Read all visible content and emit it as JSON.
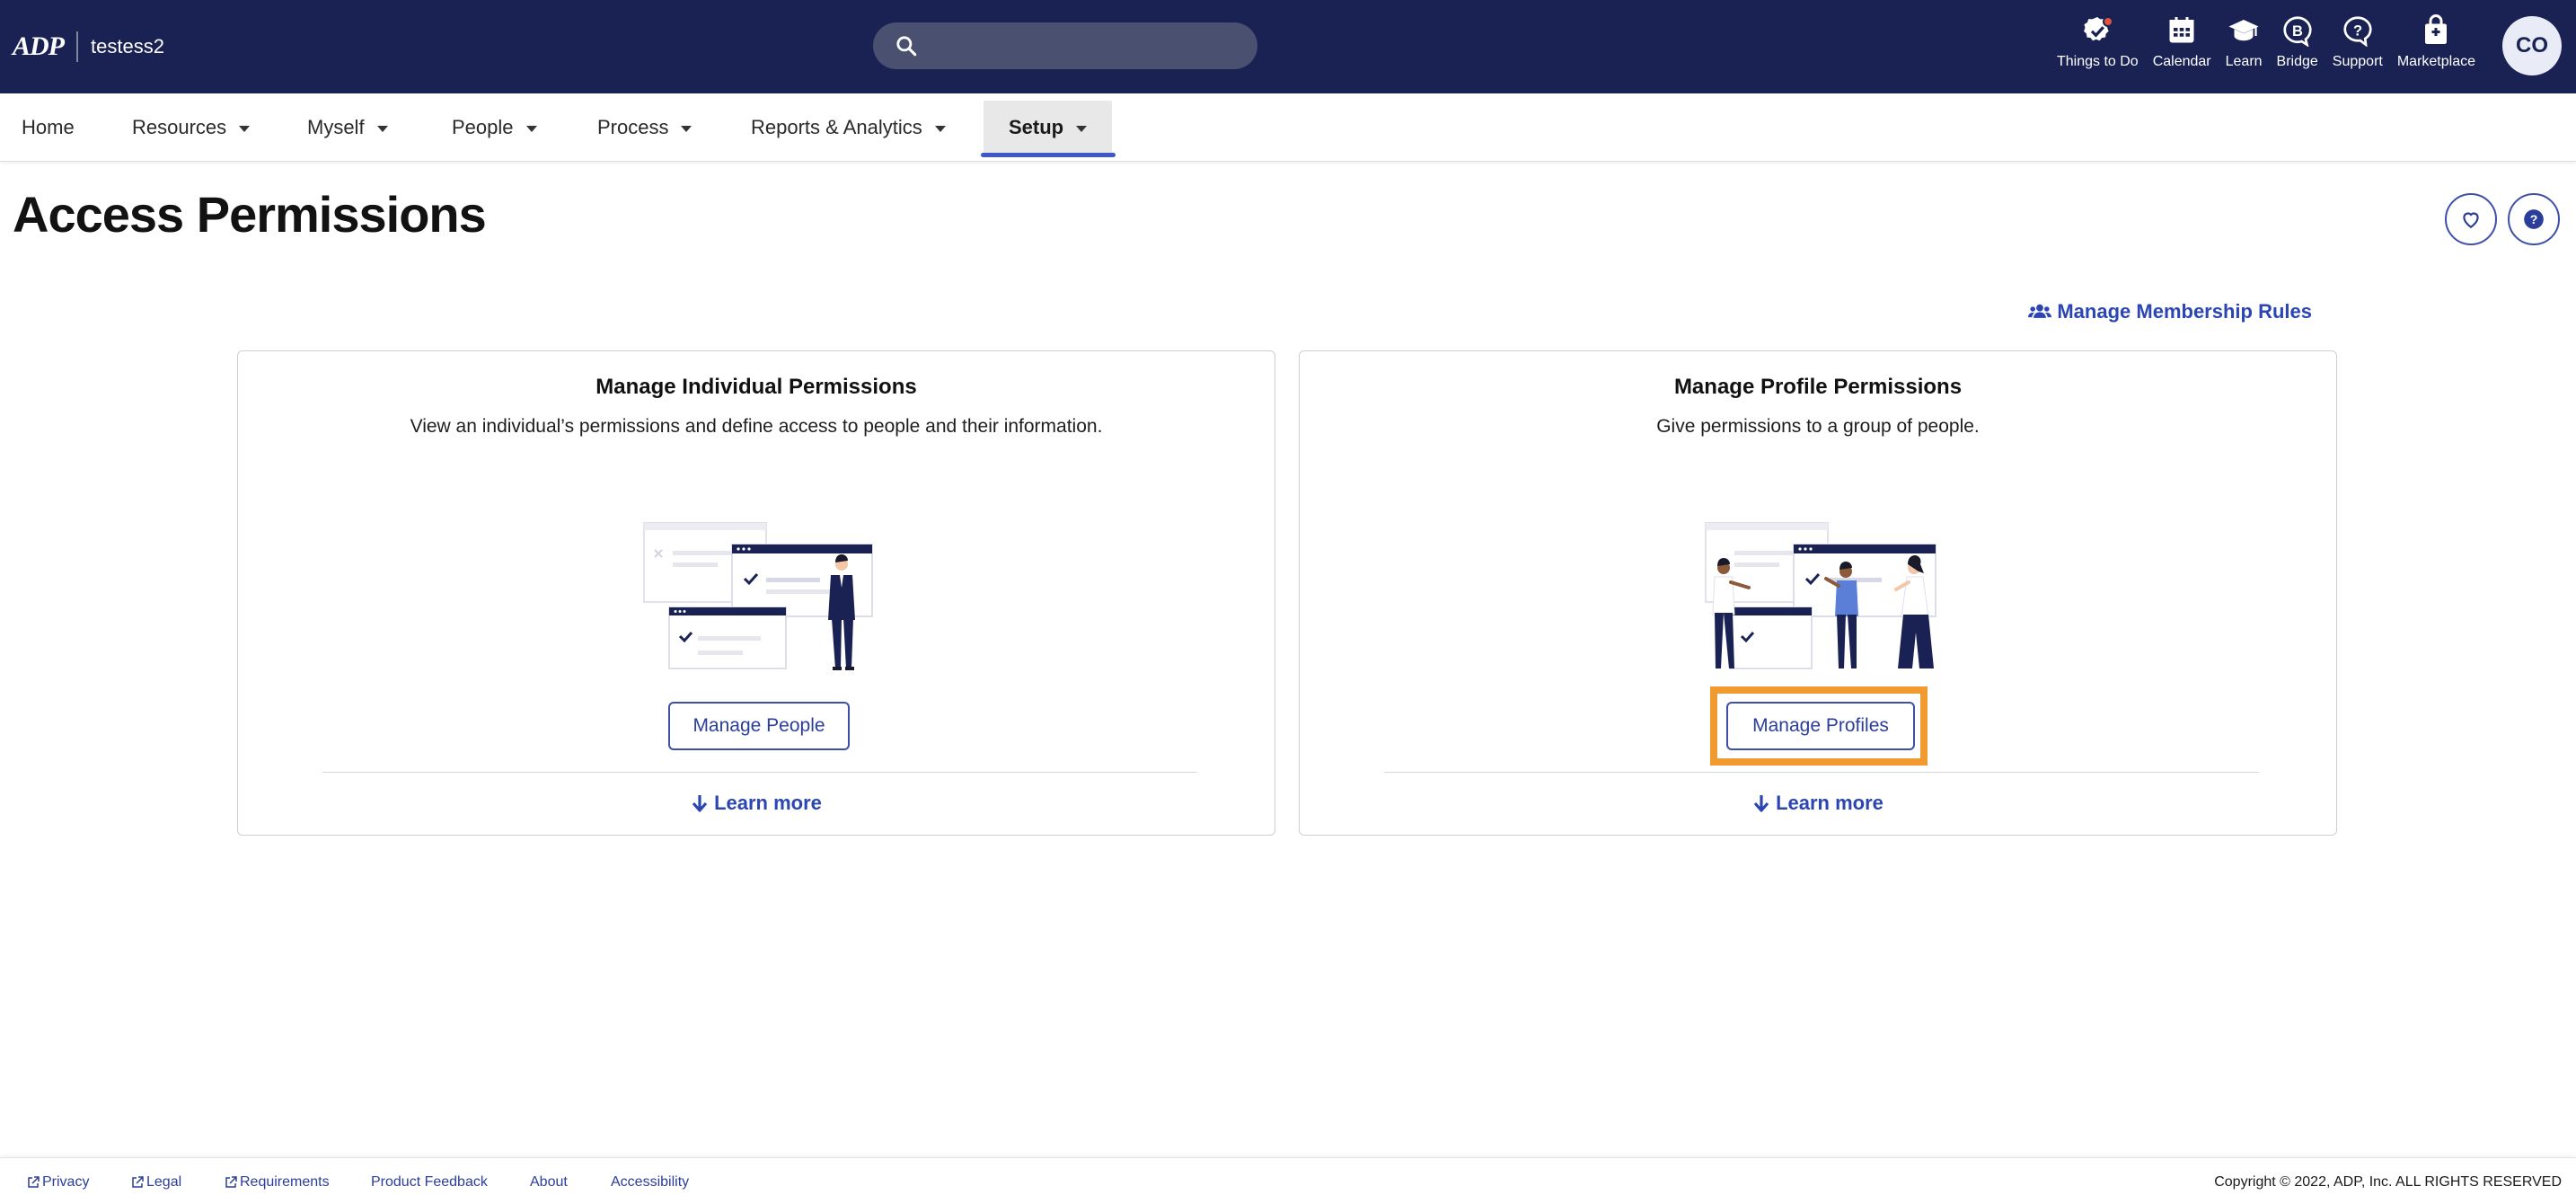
{
  "header": {
    "logo": "ADP",
    "company": "testess2",
    "search_placeholder": "",
    "icons": [
      {
        "label": "Things to Do",
        "icon": "check-badge-icon",
        "has_notification": true
      },
      {
        "label": "Calendar",
        "icon": "calendar-icon"
      },
      {
        "label": "Learn",
        "icon": "graduation-cap-icon"
      },
      {
        "label": "Bridge",
        "icon": "bridge-icon"
      },
      {
        "label": "Support",
        "icon": "question-bubble-icon"
      },
      {
        "label": "Marketplace",
        "icon": "shopping-bag-icon"
      }
    ],
    "avatar_initials": "CO"
  },
  "nav": {
    "items": [
      {
        "label": "Home"
      },
      {
        "label": "Resources"
      },
      {
        "label": "Myself"
      },
      {
        "label": "People"
      },
      {
        "label": "Process"
      },
      {
        "label": "Reports & Analytics"
      },
      {
        "label": "Setup"
      }
    ],
    "active": "Setup"
  },
  "page": {
    "title": "Access Permissions",
    "manage_rules_label": "Manage Membership Rules"
  },
  "cards": [
    {
      "title": "Manage Individual Permissions",
      "description": "View an individual’s permissions and define access to people and their information.",
      "button": "Manage People",
      "learn_more": "Learn more"
    },
    {
      "title": "Manage Profile Permissions",
      "description": "Give permissions to a group of people.",
      "button": "Manage Profiles",
      "learn_more": "Learn more"
    }
  ],
  "footer": {
    "links": [
      "Privacy",
      "Legal",
      "Requirements",
      "Product Feedback",
      "About",
      "Accessibility"
    ],
    "copyright": "Copyright © 2022, ADP, Inc. ALL RIGHTS RESERVED"
  },
  "colors": {
    "header_bg": "#1a2254",
    "accent": "#3e57c9",
    "link": "#2b45b3",
    "highlight": "#f09a30"
  }
}
